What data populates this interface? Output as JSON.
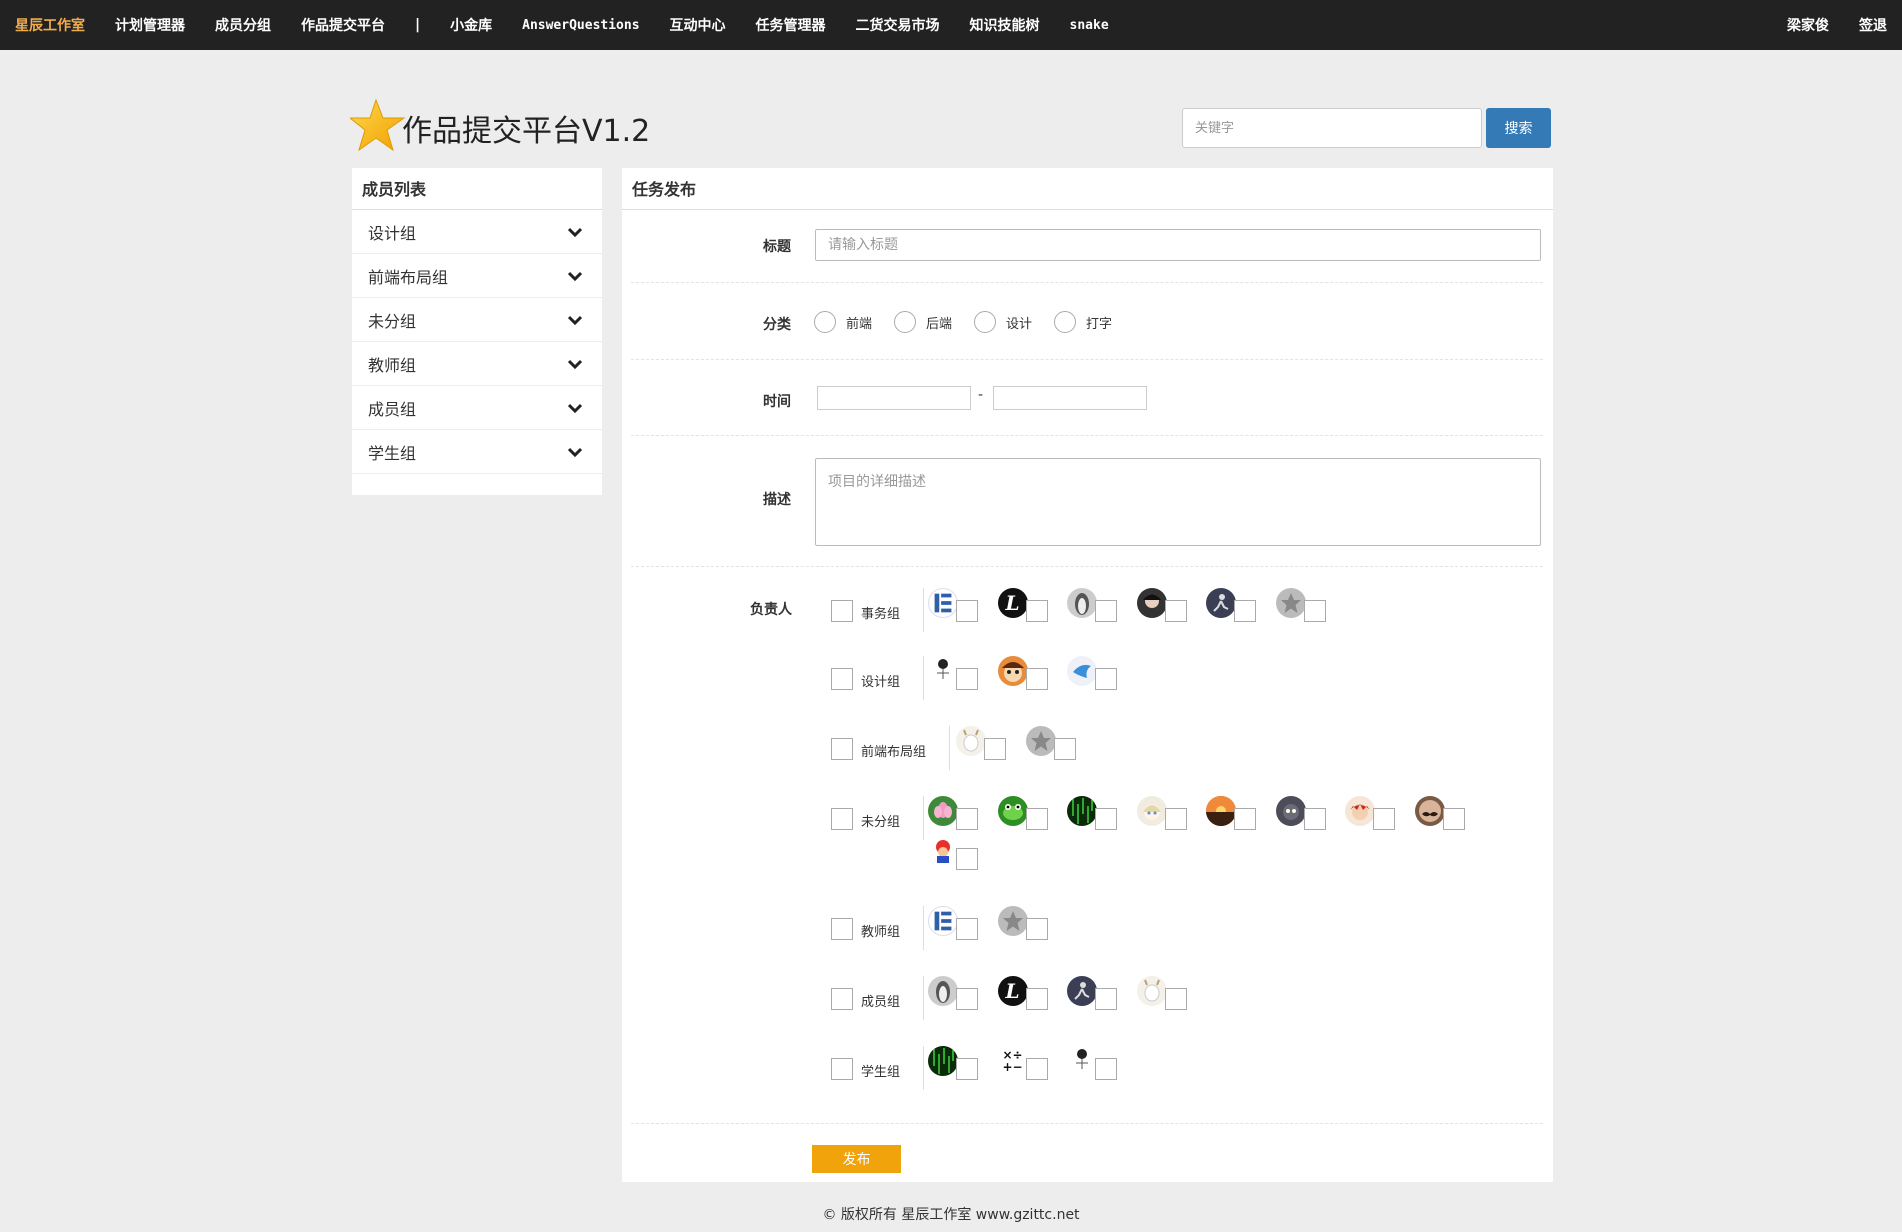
{
  "nav": {
    "brand": "星辰工作室",
    "items": [
      "计划管理器",
      "成员分组",
      "作品提交平台",
      "|",
      "小金库",
      "AnswerQuestions",
      "互动中心",
      "任务管理器",
      "二货交易市场",
      "知识技能树",
      "snake"
    ],
    "user": "梁家俊",
    "signin": "签退",
    "brand_color": "#f0ad4e",
    "bg_color": "#222222"
  },
  "header": {
    "title": "作品提交平台V1.2",
    "logo_icon": "star-icon",
    "search_placeholder": "关键字",
    "search_label": "搜索",
    "search_color": "#337ab7"
  },
  "sidebar": {
    "title": "成员列表",
    "items": [
      {
        "label": "设计组"
      },
      {
        "label": "前端布局组"
      },
      {
        "label": "未分组"
      },
      {
        "label": "教师组"
      },
      {
        "label": "成员组"
      },
      {
        "label": "学生组"
      }
    ],
    "item_icon": "chevron-down-icon"
  },
  "form": {
    "title": "任务发布",
    "title_label": "标题",
    "title_placeholder": "请输入标题",
    "category_label": "分类",
    "categories": [
      "前端",
      "后端",
      "设计",
      "打字"
    ],
    "time_label": "时间",
    "time_separator": "-",
    "time_start": "",
    "time_end": "",
    "desc_label": "描述",
    "desc_placeholder": "项目的详细描述",
    "owner_label": "负责人",
    "groups": [
      {
        "name": "事务组",
        "members": [
          "avatar-blue-logo",
          "avatar-letter-l",
          "avatar-penguin",
          "avatar-person",
          "avatar-runner",
          "avatar-grey-star"
        ]
      },
      {
        "name": "设计组",
        "members": [
          "avatar-sketch-figure",
          "avatar-cartoon-face",
          "avatar-bird"
        ]
      },
      {
        "name": "前端布局组",
        "members": [
          "avatar-white-goat",
          "avatar-grey-star"
        ]
      },
      {
        "name": "未分组",
        "members": [
          "avatar-lotus",
          "avatar-green-frog",
          "avatar-matrix",
          "avatar-anime-girl",
          "avatar-sunset",
          "avatar-dark-cat",
          "avatar-red-anime",
          "avatar-mustache",
          "avatar-mario"
        ]
      },
      {
        "name": "教师组",
        "members": [
          "avatar-blue-logo",
          "avatar-grey-star"
        ]
      },
      {
        "name": "成员组",
        "members": [
          "avatar-penguin",
          "avatar-letter-l",
          "avatar-runner",
          "avatar-white-goat"
        ]
      },
      {
        "name": "学生组",
        "members": [
          "avatar-matrix",
          "avatar-math-symbols",
          "avatar-sketch-figure"
        ]
      }
    ],
    "publish_label": "发布",
    "publish_color": "#f0a30a"
  },
  "footer": {
    "text": "© 版权所有 星辰工作室 www.gzittc.net"
  }
}
